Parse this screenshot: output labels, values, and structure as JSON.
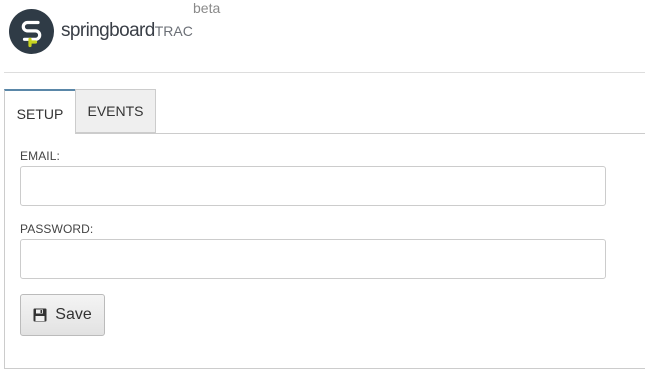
{
  "header": {
    "brand_main": "springboard",
    "brand_sub": "TRAC",
    "beta_label": "beta"
  },
  "tabs": [
    {
      "label": "SETUP",
      "active": true
    },
    {
      "label": "EVENTS",
      "active": false
    }
  ],
  "form": {
    "email_label": "EMAIL:",
    "email_value": "",
    "password_label": "PASSWORD:",
    "password_value": "",
    "save_label": "Save"
  },
  "colors": {
    "logo_circle": "#2f3b46",
    "logo_s": "#ffffff",
    "logo_accent": "#c7d31f",
    "active_tab_top": "#5a87a8"
  },
  "icons": {
    "logo": "springboard-logo-icon",
    "save": "floppy-disk-icon"
  }
}
